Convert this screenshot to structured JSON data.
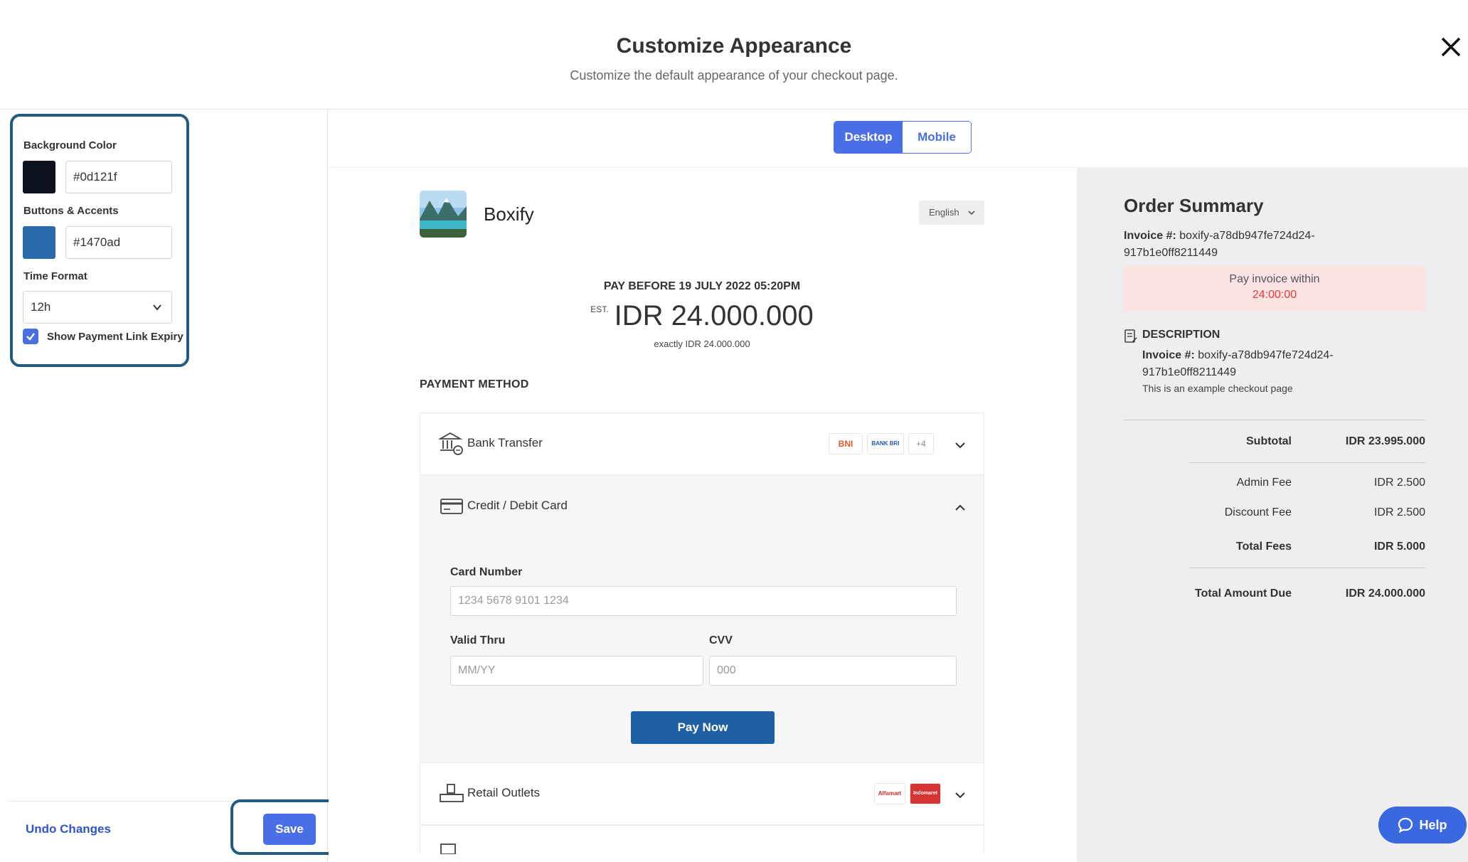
{
  "header": {
    "title": "Customize Appearance",
    "subtitle": "Customize the default appearance of your checkout page."
  },
  "settings": {
    "background_color": {
      "label": "Background Color",
      "value": "#0d121f",
      "color": "#0d121f"
    },
    "buttons_accents": {
      "label": "Buttons & Accents",
      "value": "#1470ad",
      "color": "#2b6aab"
    },
    "time_format": {
      "label": "Time Format",
      "value": "12h"
    },
    "show_expiry": {
      "label": "Show Payment Link Expiry",
      "checked": true
    }
  },
  "footer": {
    "undo_label": "Undo Changes",
    "save_label": "Save"
  },
  "view_toggle": {
    "desktop": "Desktop",
    "mobile": "Mobile",
    "active": "Desktop"
  },
  "checkout": {
    "brand": "Boxify",
    "language": "English",
    "pay_before": "PAY BEFORE 19 JULY 2022 05:20PM",
    "est_label": "EST.",
    "amount": "IDR 24.000.000",
    "exactly": "exactly IDR 24.000.000",
    "payment_method_title": "PAYMENT METHOD",
    "methods": {
      "bank_transfer": {
        "label": "Bank Transfer",
        "badges": [
          "BNI",
          "BANK BRI",
          "+4"
        ]
      },
      "card": {
        "label": "Credit / Debit Card",
        "card_number_label": "Card Number",
        "card_number_placeholder": "1234 5678 9101 1234",
        "valid_thru_label": "Valid Thru",
        "valid_thru_placeholder": "MM/YY",
        "cvv_label": "CVV",
        "cvv_placeholder": "000",
        "pay_now": "Pay Now"
      },
      "retail": {
        "label": "Retail Outlets",
        "badges": [
          "Alfamart",
          "Indomaret"
        ]
      }
    }
  },
  "summary": {
    "title": "Order Summary",
    "invoice_label": "Invoice #:",
    "invoice_id": "boxify-a78db947fe724d24-917b1e0ff8211449",
    "pay_within_label": "Pay invoice within",
    "pay_within_time": "24:00:00",
    "description_title": "DESCRIPTION",
    "description_note": "This is an example checkout page",
    "rows": {
      "subtotal": {
        "label": "Subtotal",
        "value": "IDR 23.995.000"
      },
      "admin_fee": {
        "label": "Admin Fee",
        "value": "IDR 2.500"
      },
      "discount_fee": {
        "label": "Discount Fee",
        "value": "IDR 2.500"
      },
      "total_fees": {
        "label": "Total Fees",
        "value": "IDR 5.000"
      },
      "total_due": {
        "label": "Total Amount Due",
        "value": "IDR 24.000.000"
      }
    }
  },
  "help": {
    "label": "Help"
  }
}
